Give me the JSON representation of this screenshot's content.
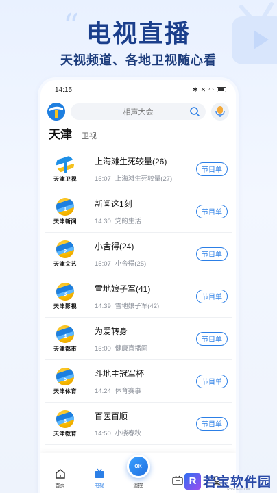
{
  "promo": {
    "title": "电视直播",
    "subtitle": "天视频道、各地卫视随心看"
  },
  "status_bar": {
    "time": "14:15",
    "battery": "98"
  },
  "search": {
    "placeholder": "相声大会"
  },
  "tabs": {
    "active": "天津",
    "other": "卫视"
  },
  "channels": [
    {
      "name": "天津卫视",
      "number": "",
      "now": "上海滩生死较量(26)",
      "next_time": "15:07",
      "next_title": "上海滩生死较量(27)",
      "guide": "节目单"
    },
    {
      "name": "天津新闻",
      "number": "1",
      "now": "新闻这1刻",
      "next_time": "14:30",
      "next_title": "党的生活",
      "guide": "节目单"
    },
    {
      "name": "天津文艺",
      "number": "2",
      "now": "小舍得(24)",
      "next_time": "15:07",
      "next_title": "小舍得(25)",
      "guide": "节目单"
    },
    {
      "name": "天津影视",
      "number": "3",
      "now": "雪地娘子军(41)",
      "next_time": "14:39",
      "next_title": "雪地娘子军(42)",
      "guide": "节目单"
    },
    {
      "name": "天津都市",
      "number": "4",
      "now": "为爱转身",
      "next_time": "15:00",
      "next_title": "健康直播间",
      "guide": "节目单"
    },
    {
      "name": "天津体育",
      "number": "5",
      "now": "斗地主冠军杯",
      "next_time": "14:24",
      "next_title": "体育赛事",
      "guide": "节目单"
    },
    {
      "name": "天津教育",
      "number": "6",
      "now": "百医百顺",
      "next_time": "14:50",
      "next_title": "小楼春秋",
      "guide": "节目单"
    }
  ],
  "bottom_nav": {
    "home": "首页",
    "tv": "电视",
    "remote": "遥控",
    "remote_center": "OK",
    "item4": "",
    "item5": ""
  },
  "watermark": {
    "brand": "若宝软件园",
    "url": "RBSOFT.COM"
  },
  "colors": {
    "accent": "#2c7fe6",
    "title": "#1b3f8c"
  }
}
